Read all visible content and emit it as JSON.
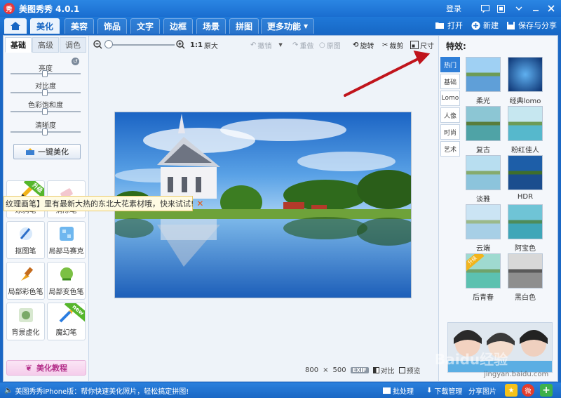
{
  "app": {
    "title": "美图秀秀 4.0.1",
    "logo_text": "秀"
  },
  "window": {
    "login": "登录"
  },
  "menu": {
    "tabs": [
      "美化",
      "美容",
      "饰品",
      "文字",
      "边框",
      "场景",
      "拼图"
    ],
    "more": "更多功能",
    "open": "打开",
    "new": "新建",
    "save_share": "保存与分享"
  },
  "left": {
    "tabs": [
      "基础",
      "高级",
      "调色"
    ],
    "sliders": [
      {
        "label": "亮度",
        "value": 0.5
      },
      {
        "label": "对比度",
        "value": 0.5
      },
      {
        "label": "色彩饱和度",
        "value": 0.5
      },
      {
        "label": "清晰度",
        "value": 0.5
      }
    ],
    "onekey": "一键美化",
    "tools": [
      {
        "label": "涂鸦笔",
        "badge": "升级"
      },
      {
        "label": "消除笔",
        "badge": ""
      },
      {
        "label": "抠图笔",
        "badge": ""
      },
      {
        "label": "局部马赛克",
        "badge": ""
      },
      {
        "label": "局部彩色笔",
        "badge": ""
      },
      {
        "label": "局部变色笔",
        "badge": ""
      },
      {
        "label": "背景虚化",
        "badge": ""
      },
      {
        "label": "魔幻笔",
        "badge": "new"
      }
    ],
    "tutorial": "美化教程"
  },
  "banner": {
    "text": "纹理画笔】里有最新大热的东北大花素材哦，快来试试!",
    "close": "✕"
  },
  "toolbar": {
    "ratio": "1:1",
    "original_size": "原大",
    "undo": "撤销",
    "redo": "重做",
    "reset": "原图",
    "rotate": "旋转",
    "crop": "裁剪",
    "resize": "尺寸"
  },
  "canvas": {
    "width": "800",
    "times": "×",
    "height": "500",
    "exif": "EXIF",
    "compare": "对比",
    "preview": "预览"
  },
  "effects": {
    "title": "特效:",
    "categories": [
      "热门",
      "基础",
      "Lomo",
      "人像",
      "时尚",
      "艺术"
    ],
    "items": [
      {
        "label": "柔光",
        "badge": ""
      },
      {
        "label": "经典lomo",
        "badge": ""
      },
      {
        "label": "复古",
        "badge": ""
      },
      {
        "label": "粉红佳人",
        "badge": ""
      },
      {
        "label": "淡雅",
        "badge": ""
      },
      {
        "label": "HDR",
        "badge": ""
      },
      {
        "label": "云端",
        "badge": ""
      },
      {
        "label": "阿宝色",
        "badge": ""
      },
      {
        "label": "后青春",
        "badge": "升级"
      },
      {
        "label": "黑白色",
        "badge": ""
      }
    ]
  },
  "status": {
    "message": "美图秀秀iPhone版：帮你快速美化照片，轻松搞定拼图!",
    "batch": "批处理",
    "download": "下载管理",
    "share": "分享图片"
  },
  "watermark": "Baidu经验",
  "watermark_url": "jingyan.baidu.com",
  "colors": {
    "titlebar": "#1a6ed0",
    "accent": "#2f7fd8",
    "arrow": "#c0141c"
  }
}
